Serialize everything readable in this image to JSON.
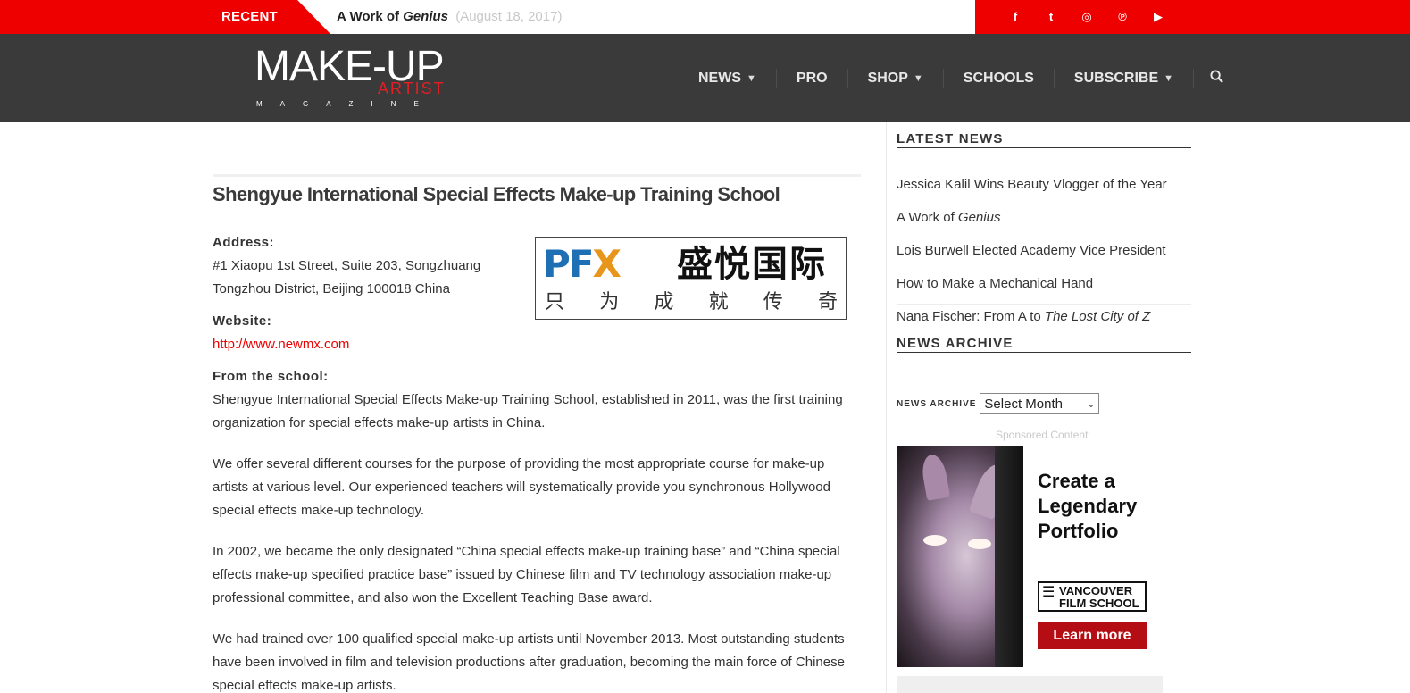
{
  "topbar": {
    "recent_label": "RECENT",
    "ticker_title_prefix": "A Work of ",
    "ticker_title_italic": "Genius",
    "ticker_date": "(August 18, 2017)",
    "social": [
      {
        "icon": "facebook-icon",
        "glyph": "f"
      },
      {
        "icon": "twitter-icon",
        "glyph": "t"
      },
      {
        "icon": "instagram-icon",
        "glyph": "◎"
      },
      {
        "icon": "pinterest-icon",
        "glyph": "℗"
      },
      {
        "icon": "youtube-icon",
        "glyph": "▶"
      }
    ],
    "accent_color": "#ee0000"
  },
  "header": {
    "logo_main": "MAKE-UP",
    "logo_artist": "ARTIST",
    "logo_magazine": "MAGAZINE",
    "nav": [
      {
        "label": "NEWS",
        "has_dropdown": true
      },
      {
        "label": "PRO",
        "has_dropdown": false
      },
      {
        "label": "SHOP",
        "has_dropdown": true
      },
      {
        "label": "SCHOOLS",
        "has_dropdown": false
      },
      {
        "label": "SUBSCRIBE",
        "has_dropdown": true
      }
    ],
    "background": "#3a3a3a"
  },
  "article": {
    "title": "Shengyue International Special Effects Make-up Training School",
    "address_label": "Address:",
    "address_line1": "#1 Xiaopu 1st Street, Suite 203, Songzhuang",
    "address_line2": "Tongzhou District, Beijing 100018 China",
    "website_label": "Website:",
    "website_url": "http://www.newmx.com",
    "from_label": "From the school:",
    "paragraphs": [
      "Shengyue International Special Effects Make-up Training School, established in 2011, was the first training organization for special effects make-up artists in China.",
      "We offer several different courses for the purpose of providing the most appropriate course for make-up artists at various level. Our experienced teachers will systematically provide you synchronous Hollywood special effects make-up technology.",
      "In 2002, we became the only designated “China special effects make-up training base” and “China special effects make-up specified practice base” issued by Chinese film and TV technology association make-up professional committee, and also won the Excellent Teaching Base award.",
      "We had trained over 100 qualified special make-up artists until November 2013. Most outstanding students have been involved in film and television productions after graduation, becoming the main force of Chinese special effects make-up artists."
    ],
    "school_logo": {
      "letters": [
        "P",
        "F",
        "X"
      ],
      "chinese_name": "盛悦国际",
      "chinese_slogan": [
        "只",
        "为",
        "成",
        "就",
        "传",
        "奇"
      ]
    }
  },
  "sidebar": {
    "latest_news_title": "LATEST NEWS",
    "latest_news": [
      {
        "text": "Jessica Kalil Wins Beauty Vlogger of the Year",
        "italic": ""
      },
      {
        "text": "A Work of ",
        "italic": "Genius"
      },
      {
        "text": "Lois Burwell Elected Academy Vice President",
        "italic": ""
      },
      {
        "text": "How to Make a Mechanical Hand",
        "italic": ""
      },
      {
        "text": "Nana Fischer: From A to ",
        "italic": "The Lost City of Z"
      }
    ],
    "archive_title": "NEWS ARCHIVE",
    "archive_label": "NEWS ARCHIVE",
    "archive_select_value": "Select Month",
    "sponsored_label": "Sponsored Content",
    "ad": {
      "headline_1": "Create a",
      "headline_2": "Legendary",
      "headline_3": "Portfolio",
      "school_line1": "VANCOUVER",
      "school_line2": "FILM SCHOOL",
      "button": "Learn more",
      "button_color": "#b40e14"
    }
  }
}
